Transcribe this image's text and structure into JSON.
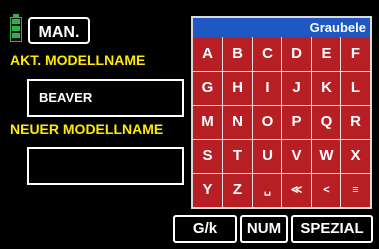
{
  "header": {
    "mode_button": "MAN.",
    "battery_icon": "battery-icon"
  },
  "labels": {
    "current_name_label": "AKT. MODELLNAME",
    "new_name_label": "NEUER MODELLNAME"
  },
  "fields": {
    "current_name_value": "BEAVER",
    "new_name_value": ""
  },
  "keyboard": {
    "header_title": "Graubele",
    "rows": [
      [
        "A",
        "B",
        "C",
        "D",
        "E",
        "F"
      ],
      [
        "G",
        "H",
        "I",
        "J",
        "K",
        "L"
      ],
      [
        "M",
        "N",
        "O",
        "P",
        "Q",
        "R"
      ],
      [
        "S",
        "T",
        "U",
        "V",
        "W",
        "X"
      ],
      [
        "Y",
        "Z",
        "␣",
        "≪",
        "<",
        "≡"
      ]
    ]
  },
  "footer": {
    "case_button": "G/k",
    "num_button": "NUM",
    "special_button": "SPEZIAL"
  },
  "colors": {
    "background": "#000000",
    "accent_yellow": "#ffea00",
    "keyboard_red": "#b81f24",
    "keyboard_header_blue": "#1f57c3",
    "battery_green": "#2fb24a"
  }
}
